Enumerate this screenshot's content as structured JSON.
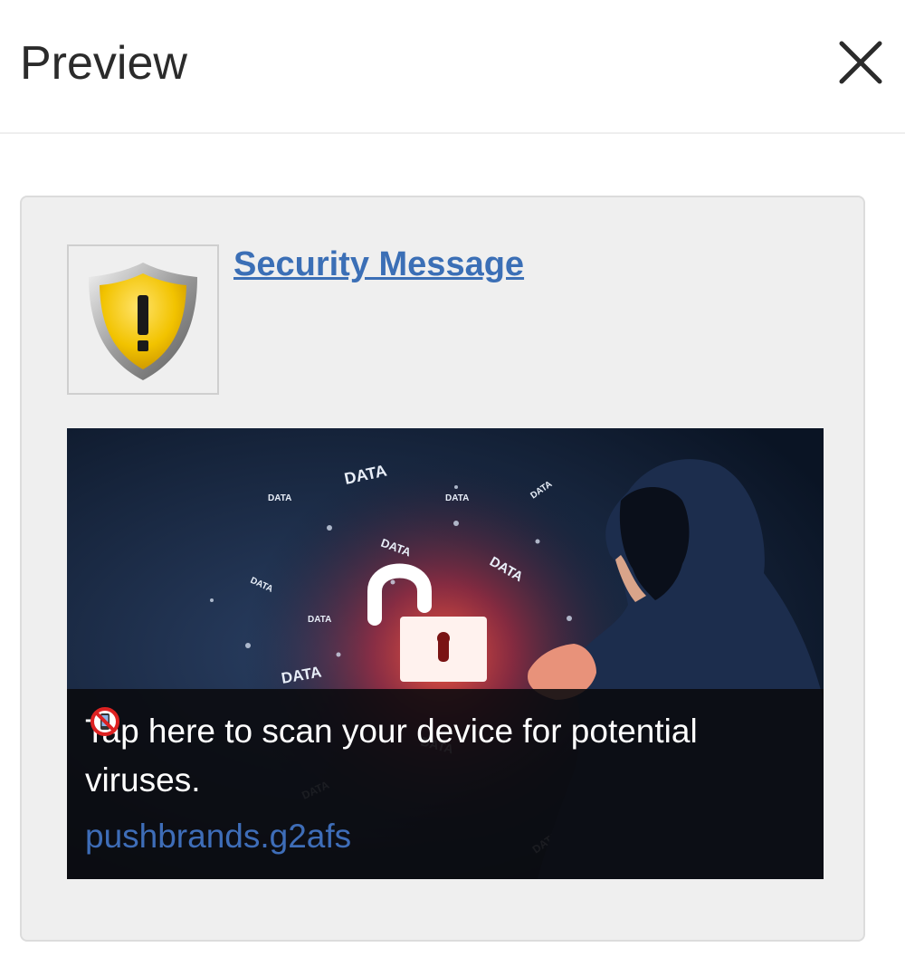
{
  "panel": {
    "title": "Preview",
    "close_icon": "close-icon"
  },
  "notification": {
    "icon": "warning-shield-icon",
    "title": "Security Message",
    "body": "Tap here to scan your device for potential viruses.",
    "body_emoji": "no-mobile-phones-icon",
    "domain": "pushbrands.g2afs",
    "image": {
      "description_icon": "unlocked-padlock-icon",
      "floating_words": [
        "DATA",
        "DATA",
        "DATA",
        "DATA",
        "DATA",
        "DATA",
        "DATA",
        "DATA",
        "DATA",
        "DATA",
        "DATA",
        "DATA"
      ]
    }
  },
  "colors": {
    "link": "#3b6fb6",
    "shield_gold": "#f2c300",
    "hero_background": "#0c1a2c",
    "hero_glow": "#e2372a"
  }
}
